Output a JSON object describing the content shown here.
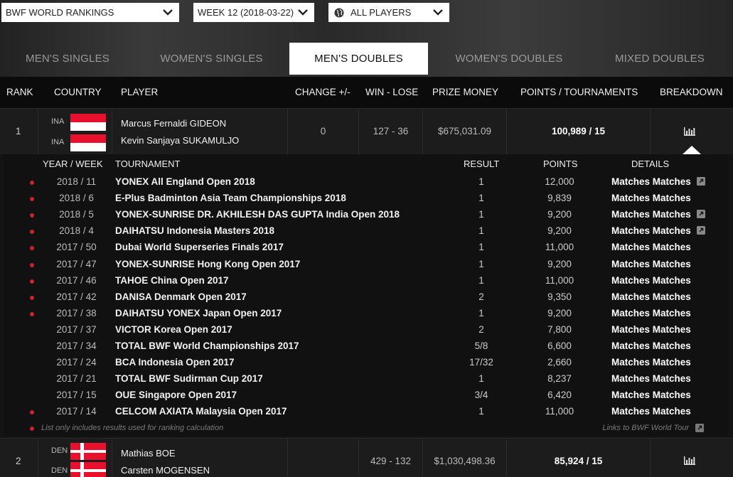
{
  "selectors": {
    "rankings": "BWF WORLD RANKINGS",
    "week": "WEEK 12 (2018-03-22)",
    "players": "ALL PLAYERS"
  },
  "tabs": [
    "MEN'S SINGLES",
    "WOMEN'S SINGLES",
    "MEN'S DOUBLES",
    "WOMEN'S DOUBLES",
    "MIXED DOUBLES"
  ],
  "active_tab": "MEN'S DOUBLES",
  "columns": {
    "rank": "RANK",
    "country": "COUNTRY",
    "player": "PLAYER",
    "change": "CHANGE +/-",
    "winlose": "WIN - LOSE",
    "prize": "PRIZE MONEY",
    "points": "POINTS / TOURNAMENTS",
    "breakdown": "BREAKDOWN"
  },
  "rankings": [
    {
      "rank": "1",
      "countries": [
        "INA",
        "INA"
      ],
      "players": [
        "Marcus Fernaldi GIDEON",
        "Kevin Sanjaya SUKAMULJO"
      ],
      "change": "0",
      "winlose": "127 - 36",
      "prize": "$675,031.09",
      "points": "100,989 / 15"
    },
    {
      "rank": "2",
      "countries": [
        "DEN",
        "DEN"
      ],
      "players": [
        "Mathias BOE",
        "Carsten MOGENSEN"
      ],
      "change": "",
      "winlose": "429 - 132",
      "prize": "$1,030,498.36",
      "points": "85,924 / 15"
    }
  ],
  "breakdown": {
    "headers": {
      "yearweek": "YEAR / WEEK",
      "tournament": "TOURNAMENT",
      "result": "RESULT",
      "points": "POINTS",
      "details": "DETAILS"
    },
    "rows": [
      {
        "yw": "2018 / 11",
        "t": "YONEX All England Open 2018",
        "r": "1",
        "p": "12,000",
        "d": "Matches Matches",
        "dot": true,
        "link": true
      },
      {
        "yw": "2018 / 6",
        "t": "E-Plus Badminton Asia Team Championships 2018",
        "r": "1",
        "p": "9,839",
        "d": "Matches Matches",
        "dot": true,
        "link": false
      },
      {
        "yw": "2018 / 5",
        "t": "YONEX-SUNRISE DR. AKHILESH DAS GUPTA India Open 2018",
        "r": "1",
        "p": "9,200",
        "d": "Matches Matches",
        "dot": true,
        "link": true
      },
      {
        "yw": "2018 / 4",
        "t": "DAIHATSU Indonesia Masters 2018",
        "r": "1",
        "p": "9,200",
        "d": "Matches Matches",
        "dot": true,
        "link": true
      },
      {
        "yw": "2017 / 50",
        "t": "Dubai World Superseries Finals 2017",
        "r": "1",
        "p": "11,000",
        "d": "Matches Matches",
        "dot": true,
        "link": false
      },
      {
        "yw": "2017 / 47",
        "t": "YONEX-SUNRISE Hong Kong Open 2017",
        "r": "1",
        "p": "9,200",
        "d": "Matches Matches",
        "dot": true,
        "link": false
      },
      {
        "yw": "2017 / 46",
        "t": "TAHOE China Open 2017",
        "r": "1",
        "p": "11,000",
        "d": "Matches Matches",
        "dot": true,
        "link": false
      },
      {
        "yw": "2017 / 42",
        "t": "DANISA Denmark Open 2017",
        "r": "2",
        "p": "9,350",
        "d": "Matches Matches",
        "dot": true,
        "link": false
      },
      {
        "yw": "2017 / 38",
        "t": "DAIHATSU YONEX Japan Open 2017",
        "r": "1",
        "p": "9,200",
        "d": "Matches Matches",
        "dot": true,
        "link": false
      },
      {
        "yw": "2017 / 37",
        "t": "VICTOR Korea Open 2017",
        "r": "2",
        "p": "7,800",
        "d": "Matches Matches",
        "dot": false,
        "link": false
      },
      {
        "yw": "2017 / 34",
        "t": "TOTAL BWF World Championships 2017",
        "r": "5/8",
        "p": "6,600",
        "d": "Matches Matches",
        "dot": false,
        "link": false
      },
      {
        "yw": "2017 / 24",
        "t": "BCA Indonesia Open 2017",
        "r": "17/32",
        "p": "2,660",
        "d": "Matches Matches",
        "dot": false,
        "link": false
      },
      {
        "yw": "2017 / 21",
        "t": "TOTAL BWF Sudirman Cup 2017",
        "r": "1",
        "p": "8,237",
        "d": "Matches Matches",
        "dot": false,
        "link": false
      },
      {
        "yw": "2017 / 15",
        "t": "OUE Singapore Open 2017",
        "r": "3/4",
        "p": "6,420",
        "d": "Matches Matches",
        "dot": false,
        "link": false
      },
      {
        "yw": "2017 / 14",
        "t": "CELCOM AXIATA Malaysia Open 2017",
        "r": "1",
        "p": "11,000",
        "d": "Matches Matches",
        "dot": true,
        "link": false
      }
    ],
    "footnote": "List only includes results used for ranking calculation",
    "links_note": "Links to BWF World Tour"
  },
  "colors": {
    "accent_dot": "#d0222a",
    "flag_red": "#e8112d",
    "flag_white": "#ffffff"
  }
}
